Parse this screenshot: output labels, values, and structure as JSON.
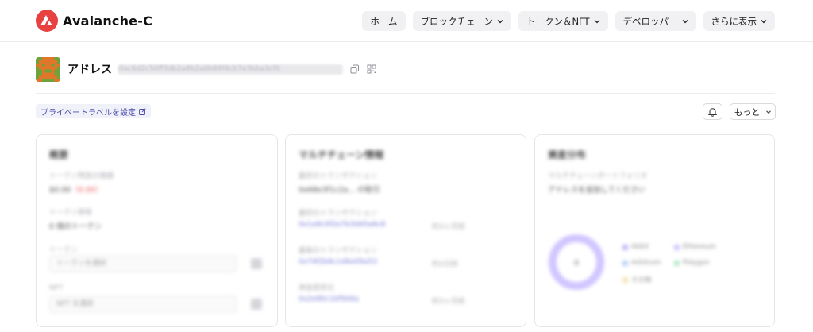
{
  "brand": {
    "name": "Avalanche-C",
    "color": "#e84142"
  },
  "nav": {
    "items": [
      {
        "label": "ホーム",
        "dropdown": false
      },
      {
        "label": "ブロックチェーン",
        "dropdown": true
      },
      {
        "label": "トークン＆NFT",
        "dropdown": true
      },
      {
        "label": "デベロッパー",
        "dropdown": true
      },
      {
        "label": "さらに表示",
        "dropdown": true
      }
    ]
  },
  "address": {
    "label": "アドレス",
    "hash": "0xc6d2c50ff3db2a8b2a0b89f4cb7e3bba3cf0"
  },
  "actions": {
    "private_label": "プライベートラベルを設定",
    "more_label": "もっと"
  },
  "cards": {
    "overview": {
      "title": "概要",
      "rows": [
        {
          "label": "トークン残高の価値",
          "value": "$0.00",
          "value_accent": "（0.00）"
        },
        {
          "label": "トークン保有",
          "value": "0 個のトークン"
        }
      ],
      "selects": [
        {
          "label": "トークン",
          "placeholder": "トークンを選択"
        },
        {
          "label": "NFT",
          "placeholder": "NFT を選択"
        }
      ]
    },
    "activity": {
      "title": "マルチチェーン情報",
      "rows": [
        {
          "label": "最初のトランザクション",
          "value": "0x68e3f1c2a...  の取引"
        },
        {
          "label": "最初のトランザクション",
          "link": "0x1a9c0f2e7b3d45a6c8",
          "extra": "約3ヶ月前"
        },
        {
          "label": "最後のトランザクション",
          "link": "0x74f2b8c1d6e09a53",
          "extra": "約2日前"
        },
        {
          "label": "資金提供元",
          "link": "0x2e80c1bf9d4a",
          "extra": "約3ヶ月前"
        }
      ]
    },
    "portfolio": {
      "title": "資産分布",
      "rows": [
        {
          "label": "マルチチェーンポートフォリオ",
          "value": "アドレスを追加してください"
        }
      ],
      "center": "0",
      "legend": [
        {
          "name": "AVAX",
          "color": "#b9a7f5"
        },
        {
          "name": "Ethereum",
          "color": "#c9b8ff"
        },
        {
          "name": "Arbitrum",
          "color": "#a9c7f3"
        },
        {
          "name": "Polygon",
          "color": "#a6e3c0"
        },
        {
          "name": "その他",
          "color": "#f3dca0"
        }
      ]
    }
  }
}
